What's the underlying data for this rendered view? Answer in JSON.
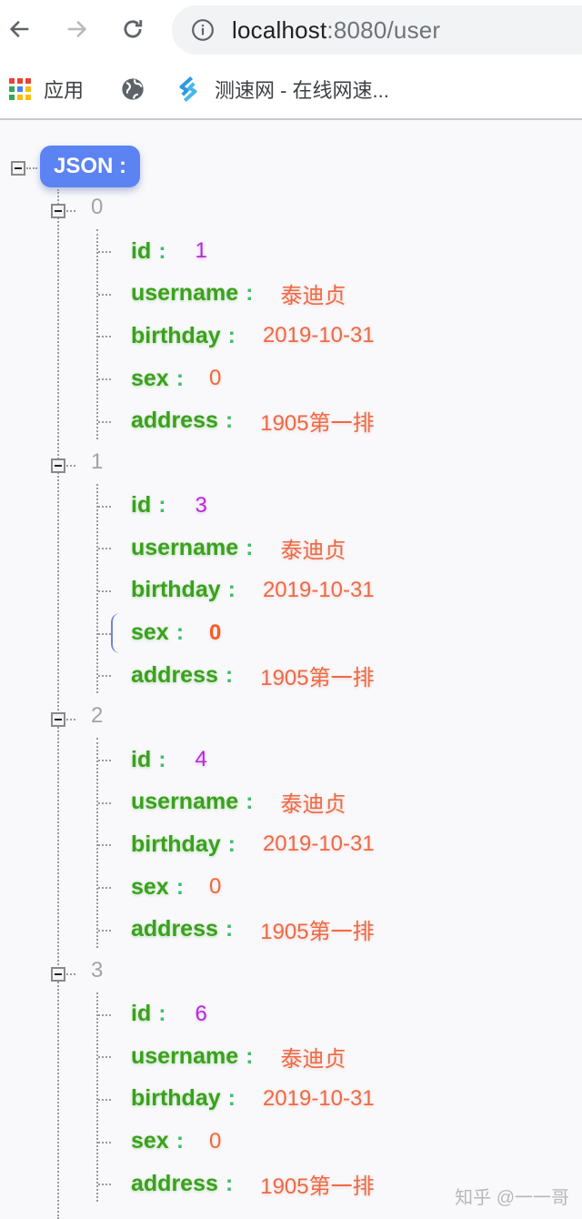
{
  "browser": {
    "url_host": "localhost",
    "url_rest": ":8080/user",
    "nav": {
      "back_icon": "arrow-left-icon",
      "forward_icon": "arrow-right-icon",
      "reload_icon": "reload-icon",
      "site_info_icon": "info-circle-icon"
    },
    "bookmarks": [
      {
        "label": "应用",
        "icon": "apps-grid-icon"
      },
      {
        "label": "",
        "icon": "globe-icon"
      },
      {
        "label": "测速网 - 在线网速...",
        "icon": "speedtest-s-icon"
      }
    ]
  },
  "viewer": {
    "root_label": "JSON :",
    "items": [
      {
        "index": "0",
        "fields": [
          {
            "key": "id",
            "value": "1",
            "type": "id"
          },
          {
            "key": "username",
            "value": "泰迪贞",
            "type": "str"
          },
          {
            "key": "birthday",
            "value": "2019-10-31",
            "type": "str"
          },
          {
            "key": "sex",
            "value": "0",
            "type": "num"
          },
          {
            "key": "address",
            "value": "1905第一排",
            "type": "str"
          }
        ]
      },
      {
        "index": "1",
        "fields": [
          {
            "key": "id",
            "value": "3",
            "type": "id"
          },
          {
            "key": "username",
            "value": "泰迪贞",
            "type": "str"
          },
          {
            "key": "birthday",
            "value": "2019-10-31",
            "type": "str"
          },
          {
            "key": "sex",
            "value": "0",
            "type": "num",
            "hovered": true
          },
          {
            "key": "address",
            "value": "1905第一排",
            "type": "str"
          }
        ]
      },
      {
        "index": "2",
        "fields": [
          {
            "key": "id",
            "value": "4",
            "type": "id"
          },
          {
            "key": "username",
            "value": "泰迪贞",
            "type": "str"
          },
          {
            "key": "birthday",
            "value": "2019-10-31",
            "type": "str"
          },
          {
            "key": "sex",
            "value": "0",
            "type": "num"
          },
          {
            "key": "address",
            "value": "1905第一排",
            "type": "str"
          }
        ]
      },
      {
        "index": "3",
        "fields": [
          {
            "key": "id",
            "value": "6",
            "type": "id"
          },
          {
            "key": "username",
            "value": "泰迪贞",
            "type": "str"
          },
          {
            "key": "birthday",
            "value": "2019-10-31",
            "type": "str"
          },
          {
            "key": "sex",
            "value": "0",
            "type": "num"
          },
          {
            "key": "address",
            "value": "1905第一排",
            "type": "str"
          }
        ]
      }
    ],
    "colon": ":"
  },
  "colors": {
    "key_green": "#3aa11d",
    "string_orange": "#ec6a45",
    "number_purple": "#b52bd6",
    "root_badge_blue": "#5b83f2",
    "index_gray": "#a3a3a3"
  },
  "watermark": "知乎 @一一哥"
}
